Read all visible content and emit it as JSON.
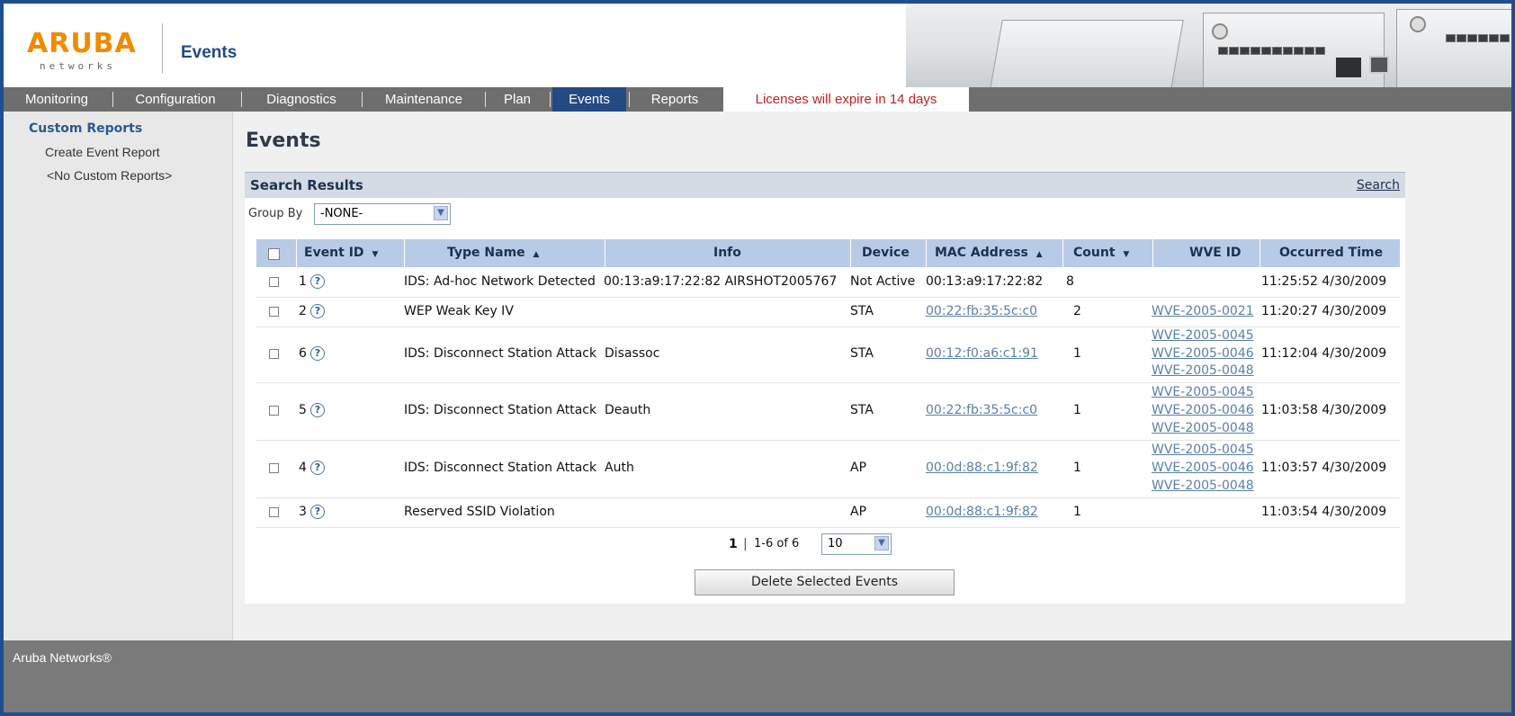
{
  "header": {
    "logo_brand": "ARUBA",
    "logo_sub": "networks",
    "app_title": "Events"
  },
  "nav": {
    "tabs": [
      {
        "label": "Monitoring"
      },
      {
        "label": "Configuration"
      },
      {
        "label": "Diagnostics"
      },
      {
        "label": "Maintenance"
      },
      {
        "label": "Plan"
      },
      {
        "label": "Events",
        "active": true
      },
      {
        "label": "Reports"
      }
    ],
    "license_notice": "Licenses will expire in 14 days"
  },
  "sidebar": {
    "heading": "Custom Reports",
    "create_link": "Create Event Report",
    "empty_text": "<No Custom Reports>"
  },
  "main": {
    "title": "Events",
    "results_title": "Search Results",
    "search_link": "Search",
    "group_by_label": "Group By",
    "group_by_value": "-NONE-",
    "columns": {
      "event_id": "Event ID",
      "event_id_sort": "▼",
      "type_name": "Type Name",
      "type_name_sort": "▲",
      "info": "Info",
      "device": "Device",
      "mac": "MAC Address",
      "mac_sort": "▲",
      "count": "Count",
      "count_sort": "▼",
      "wve": "WVE ID",
      "time": "Occurred Time"
    },
    "rows": [
      {
        "id": "1",
        "type": "IDS: Ad-hoc Network Detected",
        "info": "00:13:a9:17:22:82 AIRSHOT2005767",
        "device": "Not Active",
        "mac": "00:13:a9:17:22:82",
        "mac_link": false,
        "count": "8",
        "wve": [],
        "time": "11:25:52 4/30/2009"
      },
      {
        "id": "2",
        "type": "WEP Weak Key IV",
        "info": "",
        "device": "STA",
        "mac": "00:22:fb:35:5c:c0",
        "mac_link": true,
        "count": "2",
        "wve": [
          "WVE-2005-0021"
        ],
        "time": "11:20:27 4/30/2009"
      },
      {
        "id": "6",
        "type": "IDS: Disconnect Station Attack",
        "info": "Disassoc",
        "device": "STA",
        "mac": "00:12:f0:a6:c1:91",
        "mac_link": true,
        "count": "1",
        "wve": [
          "WVE-2005-0045",
          "WVE-2005-0046",
          "WVE-2005-0048"
        ],
        "time": "11:12:04 4/30/2009"
      },
      {
        "id": "5",
        "type": "IDS: Disconnect Station Attack",
        "info": "Deauth",
        "device": "STA",
        "mac": "00:22:fb:35:5c:c0",
        "mac_link": true,
        "count": "1",
        "wve": [
          "WVE-2005-0045",
          "WVE-2005-0046",
          "WVE-2005-0048"
        ],
        "time": "11:03:58 4/30/2009"
      },
      {
        "id": "4",
        "type": "IDS: Disconnect Station Attack",
        "info": "Auth",
        "device": "AP",
        "mac": "00:0d:88:c1:9f:82",
        "mac_link": true,
        "count": "1",
        "wve": [
          "WVE-2005-0045",
          "WVE-2005-0046",
          "WVE-2005-0048"
        ],
        "time": "11:03:57 4/30/2009"
      },
      {
        "id": "3",
        "type": "Reserved SSID Violation",
        "info": "",
        "device": "AP",
        "mac": "00:0d:88:c1:9f:82",
        "mac_link": true,
        "count": "1",
        "wve": [],
        "time": "11:03:54 4/30/2009"
      }
    ],
    "pager": {
      "current_page": "1",
      "separator": "|",
      "range": "1-6 of 6",
      "page_size": "10"
    },
    "delete_button": "Delete Selected Events"
  },
  "footer": {
    "text": "Aruba Networks®"
  },
  "colors": {
    "frame_border": "#1f4f8f",
    "nav_bg": "#6e6e6e",
    "active_tab": "#244a84",
    "license_text": "#c42020",
    "table_header": "#b8cbe6",
    "link": "#5a7fa8",
    "footer_bg": "#7a7a7a"
  },
  "icons": {
    "help": "question-circle-icon",
    "dropdown": "chevron-down-icon",
    "checkbox": "checkbox-icon"
  }
}
